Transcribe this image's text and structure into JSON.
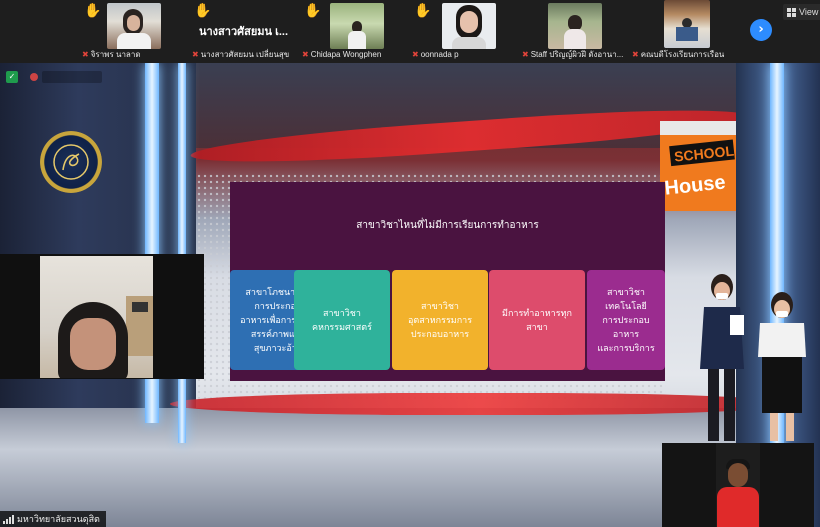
{
  "top_strip": {
    "participants": [
      {
        "name": "จิราพร นาลาด",
        "raised_hand": true,
        "has_video": true,
        "muted": true
      },
      {
        "name": "นางสาวศัสยมน เปลี่ยนสุข",
        "display_title": "นางสาวศัสยมน เ...",
        "raised_hand": true,
        "has_video": false,
        "muted": true
      },
      {
        "name": "Chidapa Wongphen",
        "raised_hand": true,
        "has_video": true,
        "muted": true
      },
      {
        "name": "oonnada p",
        "raised_hand": true,
        "has_video": true,
        "muted": true
      },
      {
        "name": "Staff ปริญญ์ผิวฝี ดังอานา...",
        "raised_hand": false,
        "has_video": true,
        "muted": true
      },
      {
        "name": "คณบดีโรงเรียนการเรือน",
        "raised_hand": false,
        "has_video": true,
        "muted": true
      }
    ],
    "next_icon": "chevron-right-icon",
    "view_label": "View"
  },
  "stage": {
    "slide": {
      "question": "สาขาวิชาไหนที่ไม่มีการเรียนการทำอาหาร",
      "options": [
        {
          "text": "สาขาโภชนาการ\nการประกอบ\nอาหารเพื่อการสร้าง\nสรรค์ภาพและ\nสุขภาวะอ้วย",
          "color": "#2e6fb3"
        },
        {
          "text": "สาขาวิชา\nคหกรรมศาสตร์",
          "color": "#2fb29b"
        },
        {
          "text": "สาขาวิชา\nอุตสาหกรรมการ\nประกอบอาหาร",
          "color": "#f2b22c"
        },
        {
          "text": "มีการทำอาหารทุก\nสาขา",
          "color": "#dd4c6c"
        },
        {
          "text": "สาขาวิชาเทคโนโลยี\nการประกอบอาหาร\nและการบริการ",
          "color": "#9b2c8f"
        }
      ]
    },
    "backdrop_brand": "SCHOOL House",
    "seal_label": "มหาวิทยาลัยสวนดุสิต SUAN DUSIT UNIVERSITY"
  },
  "bottom_label": "มหาวิทยาลัยสวนดุสิต"
}
